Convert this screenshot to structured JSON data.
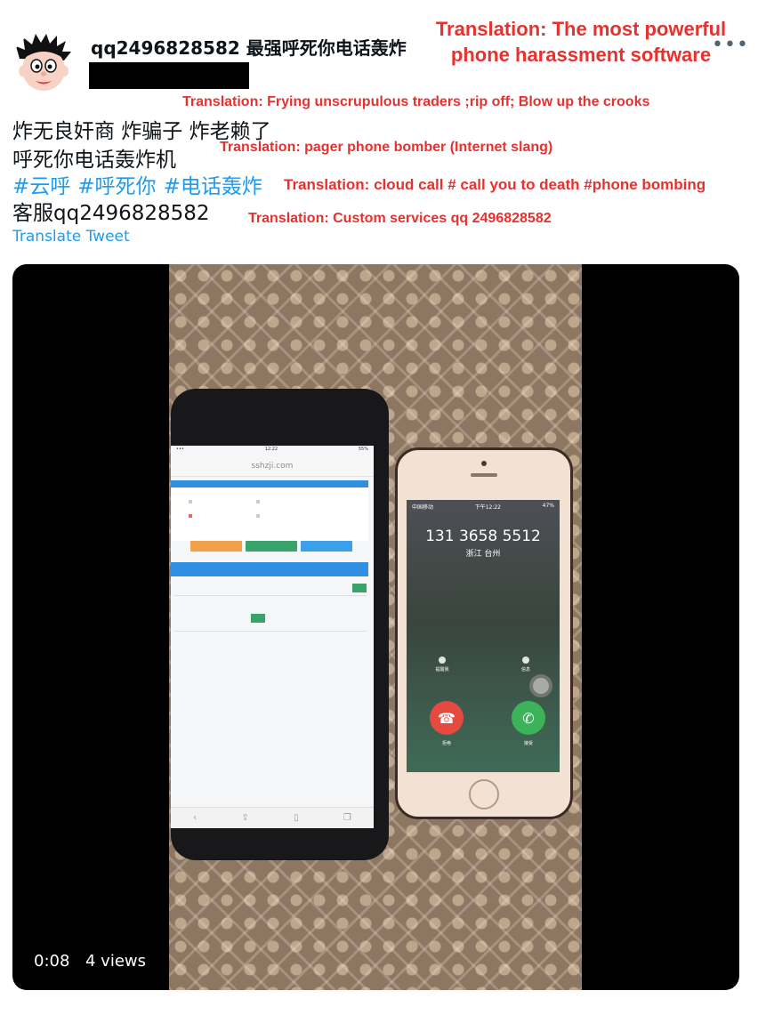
{
  "tweet": {
    "display_name": "qq2496828582 最强呼死你电话轰炸",
    "lines": [
      "炸无良奸商 炸骗子 炸老赖了",
      "呼死你电话轰炸机"
    ],
    "hashtags": [
      "#云呼",
      "#呼死你",
      "#电话轰炸"
    ],
    "contact": "客服qq2496828582",
    "translate_label": "Translate Tweet",
    "more_label": "•••"
  },
  "annotations": {
    "title": "Translation: The most powerful phone harassment software",
    "line1": "Translation: Frying unscrupulous traders ;rip off; Blow up the crooks",
    "line2": "Translation:  pager phone bomber (Internet slang)",
    "line3": "Translation: cloud call # call you to death #phone bombing",
    "line4": "Translation: Custom services qq 2496828582"
  },
  "video": {
    "time": "0:08",
    "views": "4 views",
    "left_phone": {
      "url": "sshzji.com",
      "status_time": "12:22",
      "battery": "55%"
    },
    "right_phone": {
      "carrier": "中国移动",
      "status_time": "下午12:22",
      "battery": "47%",
      "caller_number": "131 3658 5512",
      "caller_location": "浙江 台州",
      "remind_label": "提醒我",
      "message_label": "信息",
      "decline_label": "拒绝",
      "accept_label": "接受"
    }
  },
  "colors": {
    "annotation": "#e8312f",
    "link": "#1d9bf0",
    "accept": "#3cb35a",
    "decline": "#e44a3f"
  }
}
